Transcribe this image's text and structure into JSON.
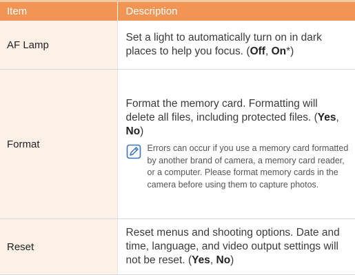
{
  "table": {
    "headers": {
      "item": "Item",
      "description": "Description"
    },
    "rows": [
      {
        "item": "AF Lamp",
        "description": "Set a light to automatically turn on in dark places to help you focus. (",
        "options": [
          "Off",
          "On"
        ],
        "suffix": "*)"
      },
      {
        "item": "Format",
        "description": "Format the memory card. Formatting will delete all files, including protected files. (",
        "options": [
          "Yes",
          "No"
        ],
        "suffix": ")",
        "note": {
          "icon": "note-pencil-icon",
          "text": "Errors can occur if you use a memory card formatted by another brand of camera, a memory card reader, or a computer. Please format memory cards in the camera before using them to capture photos."
        }
      },
      {
        "item": "Reset",
        "description": "Reset menus and shooting options. Date and time, language, and video output settings will not be reset. (",
        "options": [
          "Yes",
          "No"
        ],
        "suffix": ")"
      }
    ]
  },
  "colors": {
    "header_bg": "#f29453",
    "item_bg": "#fdf0e6",
    "accent": "#f3c9a6",
    "icon": "#3a73b8"
  }
}
